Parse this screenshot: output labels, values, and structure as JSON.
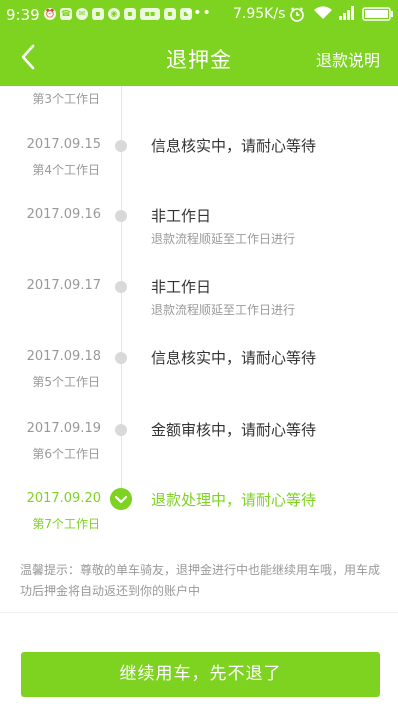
{
  "status_bar": {
    "time": "9:39",
    "network_speed": "7.95K/s",
    "dots": "•••",
    "notification_icons": [
      "alarm-icon",
      "phone-icon",
      "message-icon",
      "app-icon",
      "app-icon",
      "app-icon",
      "app-icon",
      "app-icon",
      "app-icon"
    ],
    "icons": [
      "clock-icon",
      "wifi-icon",
      "signal-icon",
      "battery-icon"
    ]
  },
  "header": {
    "title": "退押金",
    "right_link": "退款说明",
    "back_icon": "chevron-left-icon"
  },
  "timeline": {
    "partial_top_workday": "第3个工作日",
    "steps": [
      {
        "date": "2017.09.15",
        "workday": "第4个工作日",
        "status": "信息核实中，请耐心等待",
        "sub": ""
      },
      {
        "date": "2017.09.16",
        "workday": "",
        "status": "非工作日",
        "sub": "退款流程顺延至工作日进行"
      },
      {
        "date": "2017.09.17",
        "workday": "",
        "status": "非工作日",
        "sub": "退款流程顺延至工作日进行"
      },
      {
        "date": "2017.09.18",
        "workday": "第5个工作日",
        "status": "信息核实中，请耐心等待",
        "sub": ""
      },
      {
        "date": "2017.09.19",
        "workday": "第6个工作日",
        "status": "金额审核中，请耐心等待",
        "sub": ""
      },
      {
        "date": "2017.09.20",
        "workday": "第7个工作日",
        "status": "退款处理中，请耐心等待",
        "sub": "",
        "active": true
      }
    ]
  },
  "tip": "温馨提示：尊敬的单车骑友，退押金进行中也能继续用车哦，用车成功后押金将自动返还到你的账户中",
  "continue_button": "继续用车，先不退了",
  "colors": {
    "accent": "#7ed321",
    "muted": "#999999",
    "text": "#333333"
  }
}
